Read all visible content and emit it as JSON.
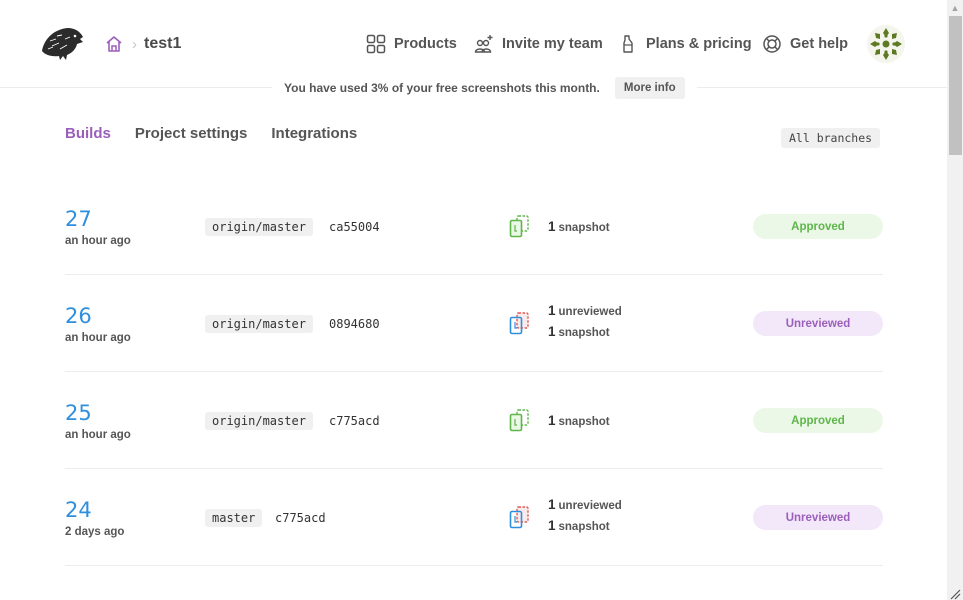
{
  "header": {
    "breadcrumb": {
      "home_icon": "home-icon",
      "separator": "›",
      "project": "test1"
    },
    "nav": [
      {
        "label": "Products",
        "icon": "grid-icon"
      },
      {
        "label": "Invite my team",
        "icon": "add-user-icon"
      },
      {
        "label": "Plans & pricing",
        "icon": "bottle-icon"
      },
      {
        "label": "Get help",
        "icon": "lifebuoy-icon"
      }
    ],
    "avatar": "user-avatar"
  },
  "usage_notice": {
    "text": "You have used 3% of your free screenshots this month.",
    "percent_used": 3,
    "button_label": "More info"
  },
  "tabs": [
    {
      "label": "Builds",
      "active": true
    },
    {
      "label": "Project settings",
      "active": false
    },
    {
      "label": "Integrations",
      "active": false
    }
  ],
  "branch_filter": "All branches",
  "builds": [
    {
      "number": "27",
      "time": "an hour ago",
      "branch": "origin/master",
      "commit": "ca55004",
      "unreviewed": null,
      "snapshots": "1",
      "snapshot_label": "snapshot",
      "status": "Approved"
    },
    {
      "number": "26",
      "time": "an hour ago",
      "branch": "origin/master",
      "commit": "0894680",
      "unreviewed": "1",
      "unreviewed_label": "unreviewed",
      "snapshots": "1",
      "snapshot_label": "snapshot",
      "status": "Unreviewed"
    },
    {
      "number": "25",
      "time": "an hour ago",
      "branch": "origin/master",
      "commit": "c775acd",
      "unreviewed": null,
      "snapshots": "1",
      "snapshot_label": "snapshot",
      "status": "Approved"
    },
    {
      "number": "24",
      "time": "2 days ago",
      "branch": "master",
      "commit": "c775acd",
      "unreviewed": "1",
      "unreviewed_label": "unreviewed",
      "snapshots": "1",
      "snapshot_label": "snapshot",
      "status": "Unreviewed"
    }
  ],
  "colors": {
    "accent_purple": "#9b5fbb",
    "build_number_blue": "#2f8fdd",
    "approved_green": "#5fb64a",
    "approved_bg": "#ebf8e8",
    "unreviewed_bg": "#f3e8fa",
    "changed_red": "#e05a5a"
  }
}
